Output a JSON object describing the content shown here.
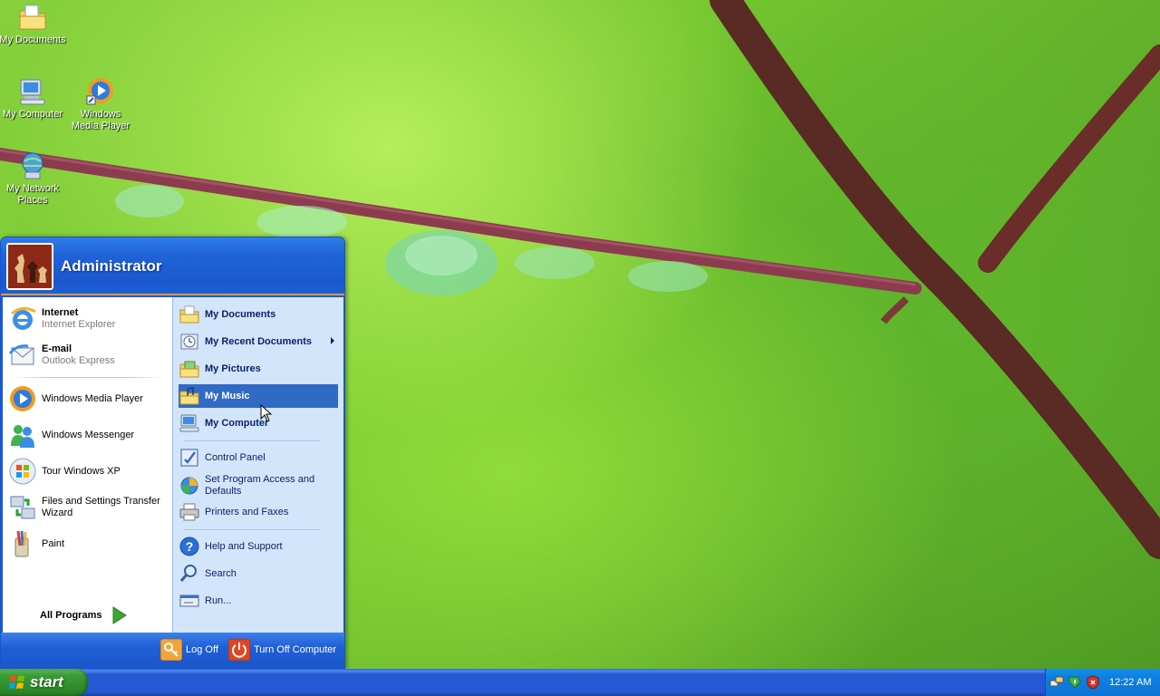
{
  "desktop": {
    "icons": [
      {
        "label": "My Documents",
        "icon": "my-documents-icon"
      },
      {
        "label": "My Computer",
        "icon": "my-computer-icon"
      },
      {
        "label": "Windows Media Player",
        "icon": "windows-media-player-icon"
      },
      {
        "label": "My Network Places",
        "icon": "my-network-places-icon"
      }
    ]
  },
  "start_menu": {
    "user": "Administrator",
    "pinned": [
      {
        "title": "Internet",
        "subtitle": "Internet Explorer",
        "icon": "internet-explorer-icon"
      },
      {
        "title": "E-mail",
        "subtitle": "Outlook Express",
        "icon": "outlook-express-icon"
      }
    ],
    "recent": [
      {
        "label": "Windows Media Player",
        "icon": "windows-media-player-icon"
      },
      {
        "label": "Windows Messenger",
        "icon": "windows-messenger-icon"
      },
      {
        "label": "Tour Windows XP",
        "icon": "tour-windows-xp-icon"
      },
      {
        "label": "Files and Settings Transfer Wizard",
        "icon": "transfer-wizard-icon"
      },
      {
        "label": "Paint",
        "icon": "paint-icon"
      }
    ],
    "all_programs": "All Programs",
    "places": [
      {
        "label": "My Documents",
        "icon": "my-documents-icon"
      },
      {
        "label": "My Recent Documents",
        "icon": "my-recent-documents-icon",
        "submenu": true
      },
      {
        "label": "My Pictures",
        "icon": "my-pictures-icon"
      },
      {
        "label": "My Music",
        "icon": "my-music-icon",
        "highlighted": true
      },
      {
        "label": "My Computer",
        "icon": "my-computer-icon"
      }
    ],
    "system": [
      {
        "label": "Control Panel",
        "icon": "control-panel-icon"
      },
      {
        "label": "Set Program Access and Defaults",
        "icon": "program-access-icon"
      },
      {
        "label": "Printers and Faxes",
        "icon": "printers-faxes-icon"
      }
    ],
    "help": [
      {
        "label": "Help and Support",
        "icon": "help-icon"
      },
      {
        "label": "Search",
        "icon": "search-icon"
      },
      {
        "label": "Run...",
        "icon": "run-icon"
      }
    ],
    "log_off": "Log Off",
    "turn_off": "Turn Off Computer"
  },
  "taskbar": {
    "start_label": "start",
    "clock": "12:22 AM"
  },
  "colors": {
    "highlight": "#316ac5",
    "taskbar_blue": "#2357d3",
    "start_green": "#3b9b38",
    "tray_blue": "#0f7fe0"
  }
}
